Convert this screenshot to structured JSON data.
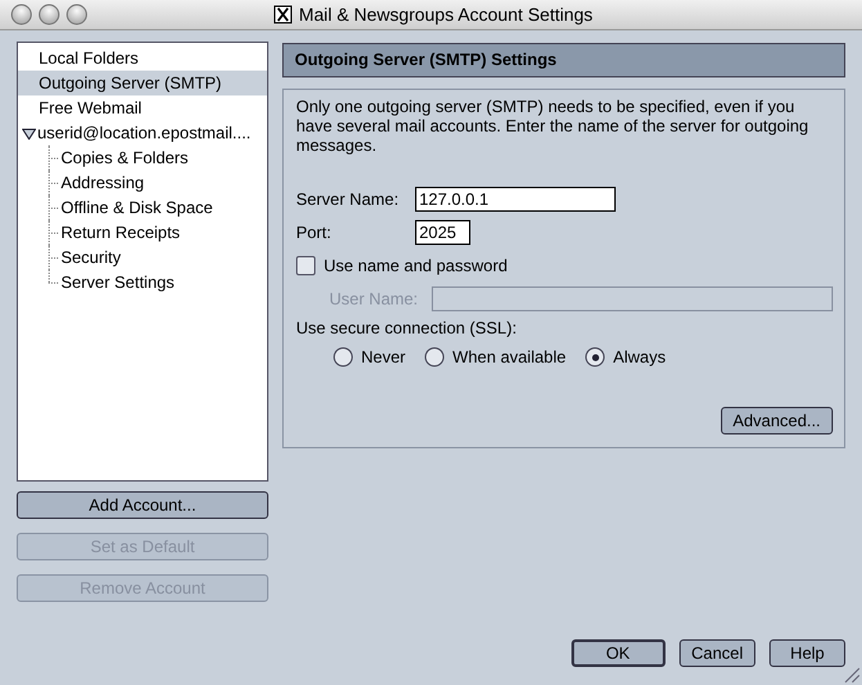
{
  "window": {
    "title": "Mail & Newsgroups Account Settings"
  },
  "sidebar": {
    "items": [
      {
        "label": "Local Folders",
        "selected": false
      },
      {
        "label": "Outgoing Server (SMTP)",
        "selected": true
      },
      {
        "label": "Free Webmail",
        "selected": false
      },
      {
        "label": "userid@location.epostmail....",
        "selected": false,
        "expanded": true,
        "children": [
          {
            "label": "Copies & Folders",
            "selected": false
          },
          {
            "label": "Addressing",
            "selected": false
          },
          {
            "label": "Offline & Disk Space",
            "selected": false
          },
          {
            "label": "Return Receipts",
            "selected": false
          },
          {
            "label": "Security",
            "selected": false
          },
          {
            "label": "Server Settings",
            "selected": false
          }
        ]
      }
    ]
  },
  "account_buttons": [
    {
      "label": "Add Account...",
      "disabled": false
    },
    {
      "label": "Set as Default",
      "disabled": true
    },
    {
      "label": "Remove Account",
      "disabled": true
    }
  ],
  "panel": {
    "title": "Outgoing Server (SMTP) Settings",
    "description": "Only one outgoing server (SMTP) needs to be specified, even if you have several mail accounts. Enter the name of the server for outgoing messages.",
    "server_name": {
      "label": "Server Name:",
      "value": "127.0.0.1"
    },
    "port": {
      "label": "Port:",
      "value": "2025"
    },
    "use_password": {
      "label": "Use name and password",
      "checked": false
    },
    "user_name": {
      "label": "User Name:",
      "disabled": true
    },
    "ssl": {
      "label": "Use secure connection (SSL):",
      "options": [
        {
          "label": "Never",
          "selected": false
        },
        {
          "label": "When available",
          "selected": false
        },
        {
          "label": "Always",
          "selected": true
        }
      ]
    },
    "advanced_button": "Advanced..."
  },
  "dialog_buttons": [
    {
      "label": "OK",
      "default": true
    },
    {
      "label": "Cancel",
      "default": false
    },
    {
      "label": "Help",
      "default": false
    }
  ]
}
